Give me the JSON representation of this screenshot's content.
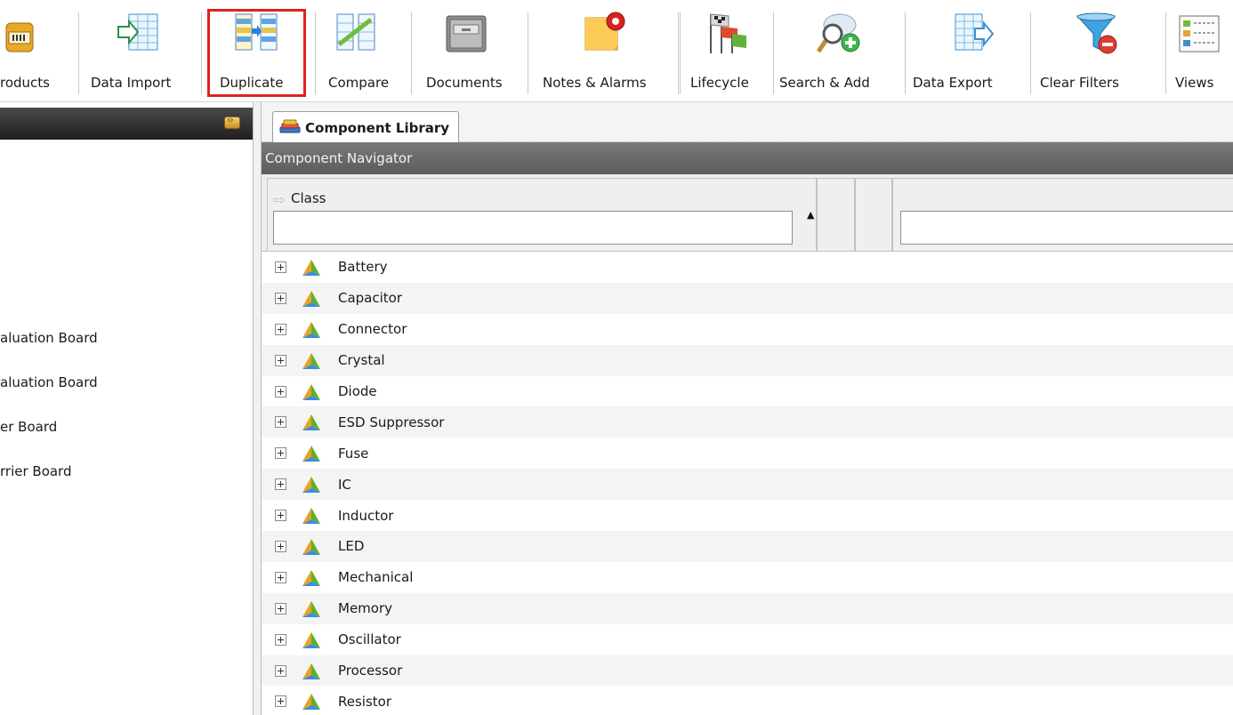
{
  "toolbar": {
    "buttons": [
      {
        "label": "roducts",
        "icon": "products-icon"
      },
      {
        "label": "Data Import",
        "icon": "data-import-icon"
      },
      {
        "label": "Duplicate",
        "icon": "duplicate-icon"
      },
      {
        "label": "Compare",
        "icon": "compare-icon"
      },
      {
        "label": "Documents",
        "icon": "documents-icon"
      },
      {
        "label": "Notes & Alarms",
        "icon": "notes-alarms-icon"
      },
      {
        "label": "Lifecycle",
        "icon": "lifecycle-icon"
      },
      {
        "label": "Search & Add",
        "icon": "search-add-icon"
      },
      {
        "label": "Data Export",
        "icon": "data-export-icon"
      },
      {
        "label": "Clear Filters",
        "icon": "clear-filters-icon"
      },
      {
        "label": "Views",
        "icon": "views-icon"
      }
    ],
    "highlighted": "Duplicate",
    "highlight_color": "#e0221e"
  },
  "left_panel": {
    "items": [
      "aluation Board",
      "aluation Board",
      "er Board",
      "rrier Board"
    ]
  },
  "tab": {
    "label": "Component Library",
    "icon": "component-library-icon"
  },
  "navigator": {
    "title": "Component Navigator",
    "column_class_label": "Class",
    "class_filter_value": "",
    "second_filter_value": ""
  },
  "rows": [
    "Battery",
    "Capacitor",
    "Connector",
    "Crystal",
    "Diode",
    "ESD Suppressor",
    "Fuse",
    "IC",
    "Inductor",
    "LED",
    "Mechanical",
    "Memory",
    "Oscillator",
    "Processor",
    "Resistor"
  ],
  "colors": {
    "header_dark": "#1f1f1f",
    "nav_header": "#6a6a6a",
    "row_alt": "#f4f4f4"
  }
}
